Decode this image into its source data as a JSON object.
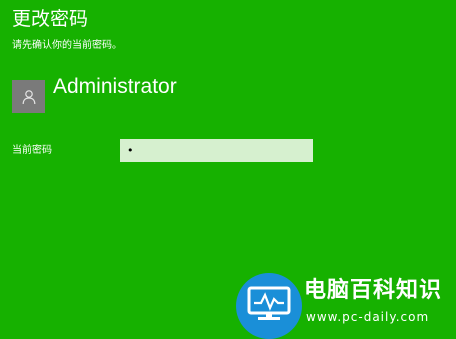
{
  "dialog": {
    "title": "更改密码",
    "instruction": "请先确认你的当前密码。"
  },
  "user": {
    "name": "Administrator",
    "avatar_icon": "user-icon"
  },
  "form": {
    "current_password_label": "当前密码",
    "current_password_value": "•"
  },
  "watermark": {
    "name": "电脑百科知识",
    "url": "www.pc-daily.com",
    "icon": "monitor-icon",
    "color": "#1a8fd8"
  },
  "colors": {
    "background": "#16b100",
    "input_background": "#d6f0cf",
    "avatar_background": "#7a7a7a"
  }
}
